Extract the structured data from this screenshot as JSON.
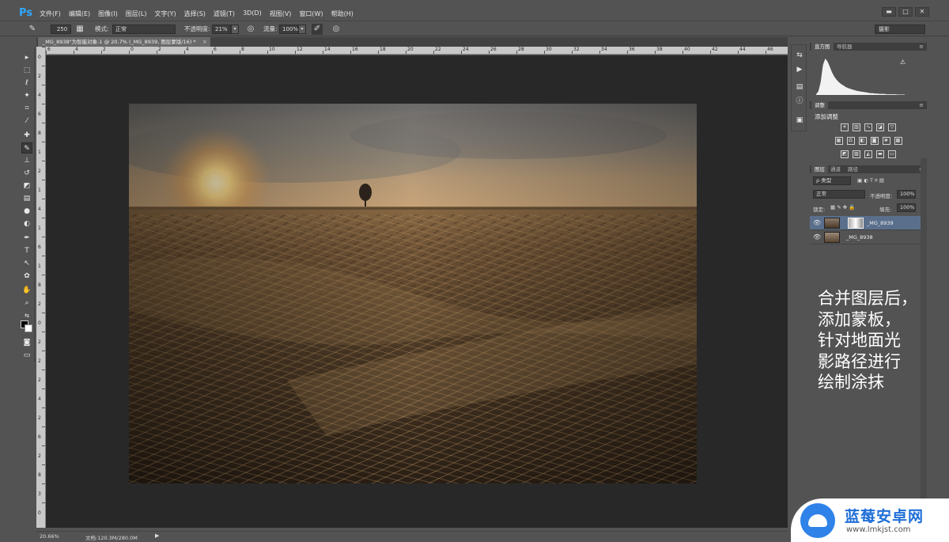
{
  "app": {
    "logo": "Ps",
    "menu": [
      "文件(F)",
      "编辑(E)",
      "图像(I)",
      "图层(L)",
      "文字(Y)",
      "选择(S)",
      "滤镜(T)",
      "3D(D)",
      "视图(V)",
      "窗口(W)",
      "帮助(H)"
    ],
    "window_controls": [
      "▬",
      "□",
      "✕"
    ]
  },
  "options": {
    "brush_size": "250",
    "mode_label": "模式:",
    "mode_value": "正常",
    "opacity_label": "不透明度:",
    "opacity_value": "21%",
    "flow_label": "流量:",
    "flow_value": "100%",
    "workspace": "摄影"
  },
  "document": {
    "tab_title": "_MG_8938\"为智能对象-1 @ 20.7% (_MG_8939, 图层蒙版/16) *",
    "tab_close": "×"
  },
  "ruler": {
    "top_numbers": [
      "6",
      "4",
      "2",
      "0",
      "2",
      "4",
      "6",
      "8",
      "10",
      "12",
      "14",
      "16",
      "18",
      "20",
      "22",
      "24",
      "26",
      "28",
      "30",
      "32",
      "34",
      "36",
      "38",
      "40",
      "42",
      "44",
      "46"
    ],
    "left_numbers": [
      "0",
      "2",
      "4",
      "6",
      "8",
      "1",
      "2",
      "1",
      "4",
      "1",
      "6",
      "1",
      "8",
      "2",
      "0",
      "2",
      "2",
      "2",
      "4",
      "2",
      "6",
      "2",
      "8",
      "3",
      "0"
    ]
  },
  "status": {
    "zoom": "20.66%",
    "doc_size": "文档:120.3M/280.0M",
    "arrow": "▶"
  },
  "panels": {
    "histogram_tabs": [
      "直方图",
      "导航器"
    ],
    "histogram_warning": "⚠",
    "histogram_levels": [
      0.02,
      0.1,
      0.35,
      0.82,
      1.0,
      0.92,
      0.78,
      0.62,
      0.5,
      0.42,
      0.35,
      0.3,
      0.26,
      0.22,
      0.19,
      0.17,
      0.15,
      0.13,
      0.11,
      0.1,
      0.09,
      0.08,
      0.07,
      0.06,
      0.05,
      0.05,
      0.04,
      0.04,
      0.03,
      0.03,
      0.03,
      0.02,
      0.02,
      0.02,
      0.02,
      0.02,
      0.01,
      0.01,
      0.01,
      0.01
    ],
    "adjust_tab": "调整",
    "adjust_title": "添加调整",
    "layers_tabs": [
      "图层",
      "通道",
      "路径"
    ],
    "layers_filter": "ρ 类型",
    "blend_mode": "正常",
    "opacity_label": "不透明度:",
    "opacity_value": "100%",
    "lock_label": "锁定:",
    "fill_label": "填充:",
    "fill_value": "100%",
    "layers": [
      {
        "name": "_MG_8939",
        "selected": true,
        "has_mask": true
      },
      {
        "name": "_MG_8938",
        "selected": false,
        "has_mask": false
      }
    ]
  },
  "annotation": "合并图层后，\n添加蒙板，\n针对地面光\n影路径进行\n绘制涂抹",
  "watermark": {
    "title": "蓝莓安卓网",
    "url": "www.lmkjst.com"
  },
  "colors": {
    "ps_blue": "#2fa8ff",
    "layer_selected": "#5a6f8c",
    "brand_blue": "#1f6fd8"
  }
}
